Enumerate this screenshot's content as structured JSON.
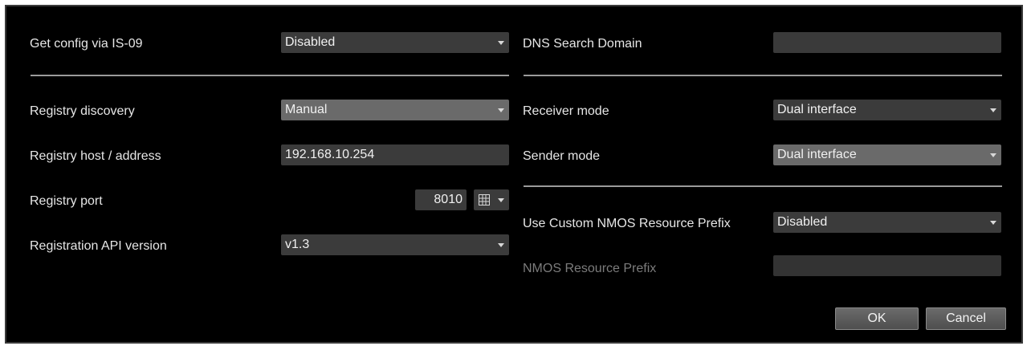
{
  "left": {
    "is09": {
      "label": "Get config via IS-09",
      "value": "Disabled"
    },
    "registry_discovery": {
      "label": "Registry discovery",
      "value": "Manual"
    },
    "registry_host": {
      "label": "Registry host / address",
      "value": "192.168.10.254"
    },
    "registry_port": {
      "label": "Registry port",
      "value": "8010"
    },
    "api_version": {
      "label": "Registration API version",
      "value": "v1.3"
    }
  },
  "right": {
    "dns": {
      "label": "DNS Search Domain",
      "value": ""
    },
    "receiver_mode": {
      "label": "Receiver mode",
      "value": "Dual interface"
    },
    "sender_mode": {
      "label": "Sender mode",
      "value": "Dual interface"
    },
    "custom_prefix": {
      "label": "Use Custom NMOS Resource Prefix",
      "value": "Disabled"
    },
    "resource_prefix": {
      "label": "NMOS Resource Prefix",
      "value": ""
    }
  },
  "buttons": {
    "ok": "OK",
    "cancel": "Cancel"
  },
  "icons": {
    "keypad": "keypad-icon",
    "dropdown": "chevron-down-icon"
  },
  "colors": {
    "background": "#000000",
    "field": "#3b3b3b",
    "highlight": "#6a6a6a",
    "text": "#e6e6e6"
  }
}
